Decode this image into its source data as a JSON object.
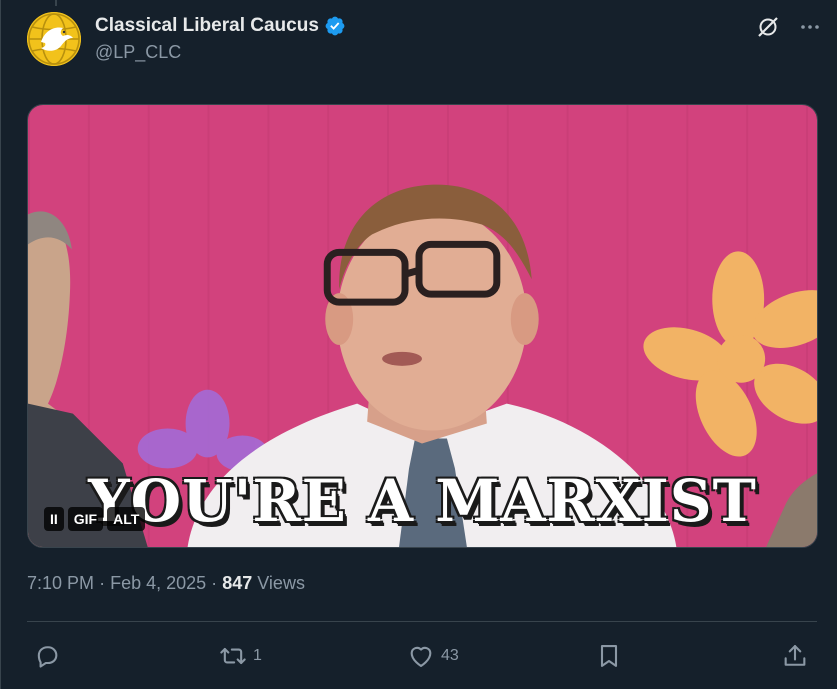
{
  "account": {
    "display_name": "Classical Liberal Caucus",
    "handle": "@LP_CLC",
    "avatar_icon": "dove-globe-logo",
    "verified_icon": "verified-badge-icon",
    "verified_color": "#1d9bf0"
  },
  "header_actions": {
    "grok_icon": "grok-icon",
    "more_icon": "more-icon"
  },
  "media": {
    "type": "GIF",
    "caption": "YOU'RE A MARXIST",
    "controls": {
      "pause_label": "II",
      "gif_label": "GIF",
      "alt_label": "ALT"
    },
    "colors": {
      "background": "#d2427d",
      "flower": "#f2b365"
    }
  },
  "meta": {
    "time": "7:10 PM",
    "separator": "·",
    "date": "Feb 4, 2025",
    "views_count": "847",
    "views_label": "Views"
  },
  "actions": {
    "reply_count": "",
    "retweet_count": "1",
    "like_count": "43",
    "bookmark_count": "",
    "share_icon": "share-icon"
  },
  "colors": {
    "background": "#15202b",
    "text_primary": "#e7e9ea",
    "text_secondary": "#8b98a5",
    "divider": "#38444d"
  }
}
